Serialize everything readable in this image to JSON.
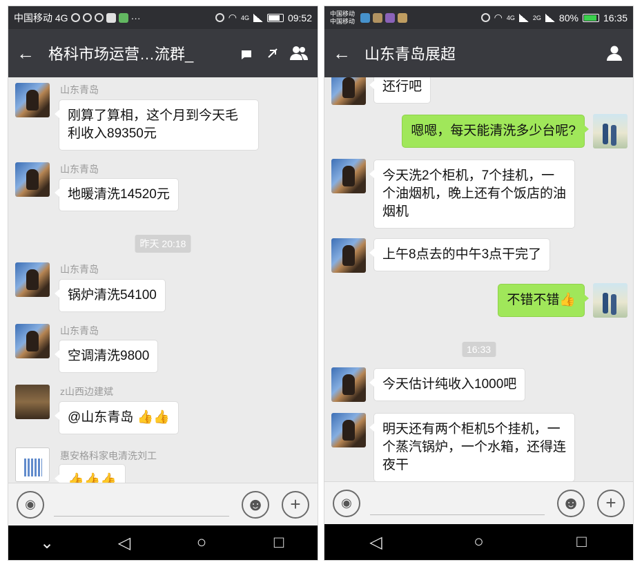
{
  "left": {
    "status": {
      "carrier": "中国移动 4G",
      "time": "09:52",
      "network": "4G"
    },
    "title": "格科市场运营…流群_",
    "messages": [
      {
        "sender": "山东青岛",
        "text": "刚算了算相，这个月到今天毛利收入89350元"
      },
      {
        "sender": "山东青岛",
        "text": "地暖清洗14520元"
      },
      {
        "sender": "山东青岛",
        "text": "锅炉清洗54100"
      },
      {
        "sender": "山东青岛",
        "text": "空调清洗9800"
      },
      {
        "sender": "z山西边建斌",
        "text": "@山东青岛 👍👍"
      },
      {
        "sender": "惠安格科家电清洗刘工",
        "text": "👍👍👍"
      }
    ],
    "timestamp": "昨天 20:18"
  },
  "right": {
    "status": {
      "carrier_line1": "中国移动",
      "carrier_line2": "中国移动",
      "network1": "4G",
      "network2": "2G",
      "battery": "80%",
      "time": "16:35"
    },
    "title": "山东青岛展超",
    "messages": [
      {
        "from": "in",
        "text": "还行吧"
      },
      {
        "from": "out",
        "text": "嗯嗯，每天能清洗多少台呢?"
      },
      {
        "from": "in",
        "text": "今天洗2个柜机，7个挂机，一个油烟机，晚上还有个饭店的油烟机"
      },
      {
        "from": "in",
        "text": "上午8点去的中午3点干完了"
      },
      {
        "from": "out",
        "text": "不错不错👍"
      },
      {
        "from": "in",
        "text": "今天估计纯收入1000吧"
      },
      {
        "from": "in",
        "text": "明天还有两个柜机5个挂机，一个蒸汽锅炉，一个水箱，还得连夜干"
      }
    ],
    "timestamp": "16:33"
  },
  "colors": {
    "titlebar": "#393a3f",
    "statusbar": "#2e2f33",
    "chat_bg": "#ebebeb",
    "bubble_out": "#a0e75a",
    "bubble_in": "#ffffff"
  },
  "icons": {
    "back": "arrow-left-icon",
    "group_members": "group-icon",
    "person": "person-icon",
    "voice": "voice-icon",
    "emoji": "emoji-icon",
    "plus": "plus-icon"
  }
}
